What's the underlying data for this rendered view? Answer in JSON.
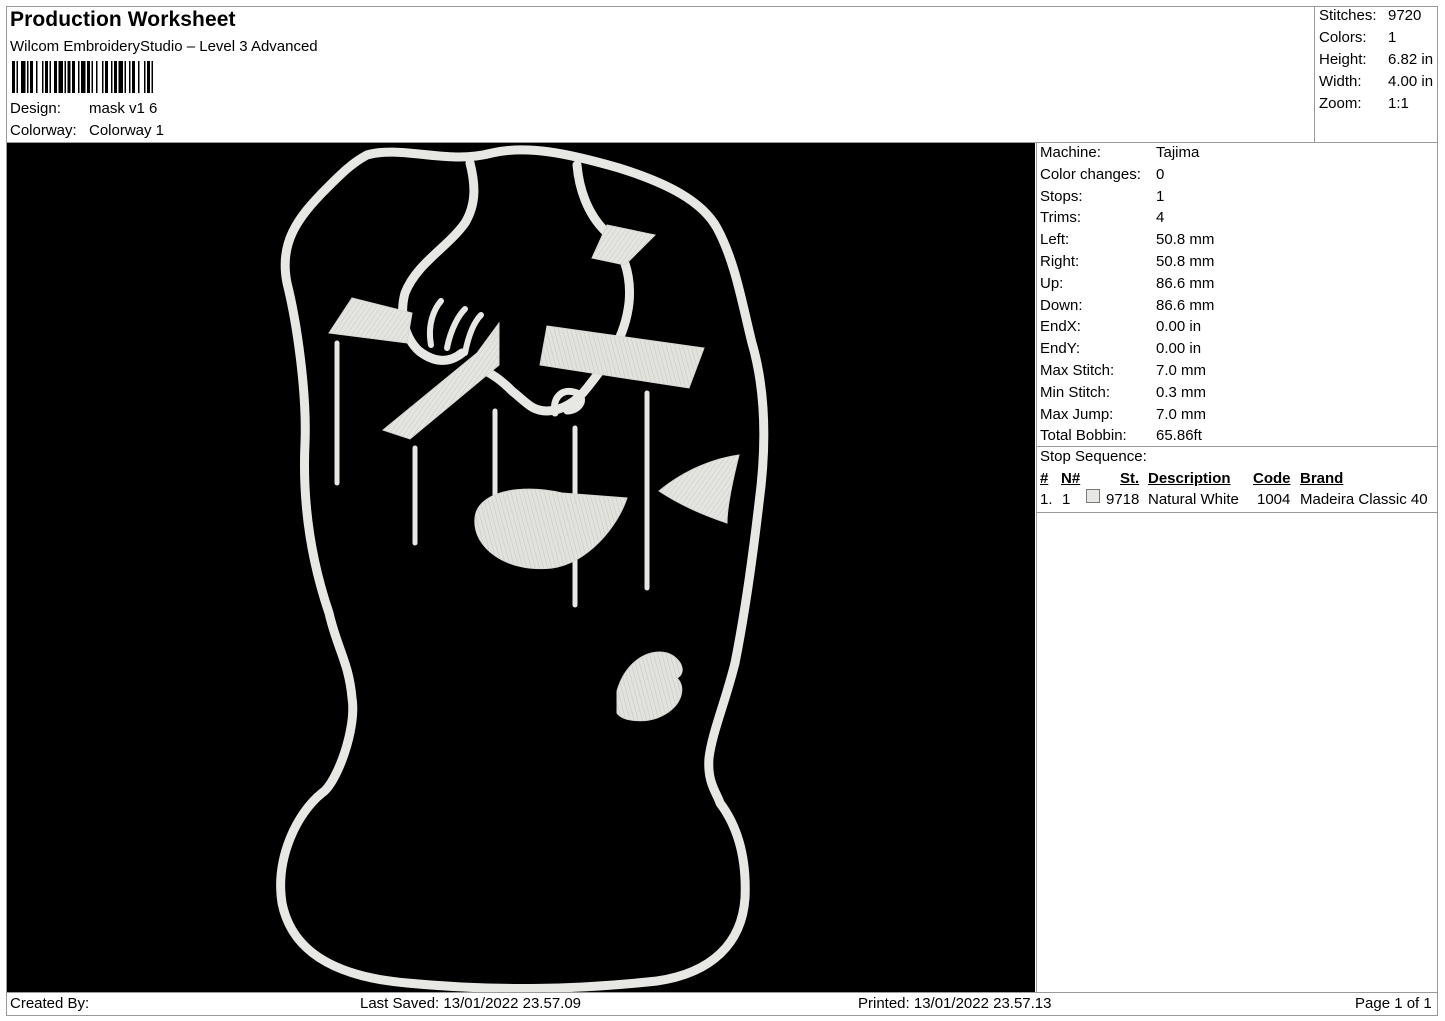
{
  "header": {
    "title": "Production Worksheet",
    "software": "Wilcom EmbroideryStudio – Level 3 Advanced",
    "design_label": "Design:",
    "design_value": "mask v1 6",
    "colorway_label": "Colorway:",
    "colorway_value": "Colorway 1"
  },
  "summary": [
    {
      "label": "Stitches:",
      "value": "9720"
    },
    {
      "label": "Colors:",
      "value": "1"
    },
    {
      "label": "Height:",
      "value": "6.82 in"
    },
    {
      "label": "Width:",
      "value": "4.00 in"
    },
    {
      "label": "Zoom:",
      "value": "1:1"
    }
  ],
  "machine_info": [
    {
      "label": "Machine:",
      "value": "Tajima"
    },
    {
      "label": "Color changes:",
      "value": "0"
    },
    {
      "label": "Stops:",
      "value": "1"
    },
    {
      "label": "Trims:",
      "value": "4"
    },
    {
      "label": "Left:",
      "value": "50.8 mm"
    },
    {
      "label": "Right:",
      "value": "50.8 mm"
    },
    {
      "label": "Up:",
      "value": "86.6 mm"
    },
    {
      "label": "Down:",
      "value": "86.6 mm"
    },
    {
      "label": "EndX:",
      "value": "0.00 in"
    },
    {
      "label": "EndY:",
      "value": "0.00 in"
    },
    {
      "label": "Max Stitch:",
      "value": "7.0 mm"
    },
    {
      "label": "Min Stitch:",
      "value": "0.3 mm"
    },
    {
      "label": "Max Jump:",
      "value": "7.0 mm"
    },
    {
      "label": "Total Bobbin:",
      "value": "65.86ft"
    }
  ],
  "stop_sequence": {
    "title": "Stop Sequence:",
    "columns": [
      "#",
      "N#",
      "St.",
      "Description",
      "Code",
      "Brand"
    ],
    "rows": [
      {
        "num": "1.",
        "n": "1",
        "swatch_color": "#e7e7e4",
        "st": "9718",
        "description": "Natural White",
        "code": "1004",
        "brand": "Madeira Classic 40"
      }
    ]
  },
  "footer": {
    "created_by": "Created By:",
    "last_saved": "Last Saved: 13/01/2022 23.57.09",
    "printed": "Printed: 13/01/2022 23.57.13",
    "page": "Page 1 of 1"
  },
  "colors": {
    "canvas_background": "#000000",
    "thread": "#e7e7e4"
  }
}
